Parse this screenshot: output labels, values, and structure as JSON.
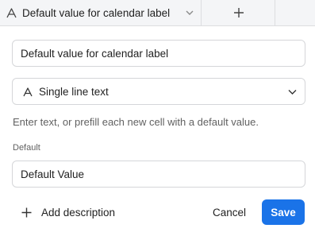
{
  "header": {
    "column_title": "Default value for calendar label",
    "column_type_icon": "text-type-icon",
    "chevron_icon": "chevron-down-icon",
    "add_column_icon": "plus-icon"
  },
  "form": {
    "field_name_value": "Default value for calendar label",
    "field_type": {
      "label": "Single line text",
      "icon": "text-type-icon",
      "chevron": "chevron-down-icon"
    },
    "hint": "Enter text, or prefill each new cell with a default value.",
    "default_label": "Default",
    "default_value": "Default Value"
  },
  "footer": {
    "add_description_label": "Add description",
    "add_description_icon": "plus-icon",
    "cancel_label": "Cancel",
    "save_label": "Save"
  },
  "colors": {
    "accent": "#1a73e8",
    "header_bg": "#f4f5f7",
    "border": "#d5d6d9",
    "muted_text": "#616161"
  }
}
